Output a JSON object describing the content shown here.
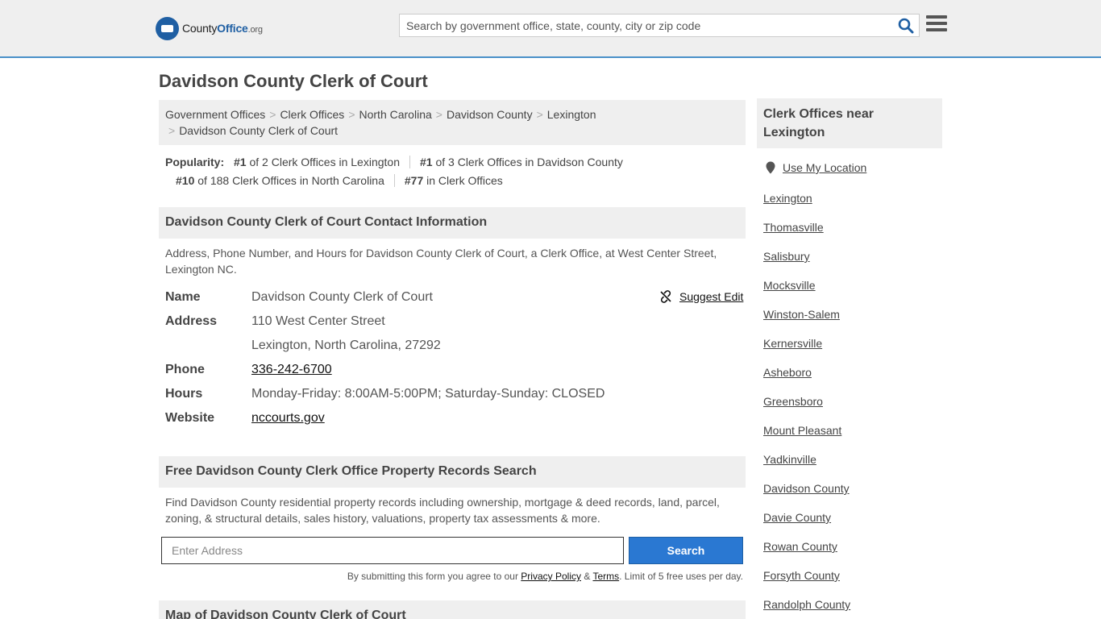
{
  "header": {
    "logo_part1": "County",
    "logo_part2": "Office",
    "logo_part3": ".org",
    "search_placeholder": "Search by government office, state, county, city or zip code"
  },
  "page_title": "Davidson County Clerk of Court",
  "breadcrumb": {
    "items": [
      "Government Offices",
      "Clerk Offices",
      "North Carolina",
      "Davidson County",
      "Lexington",
      "Davidson County Clerk of Court"
    ]
  },
  "popularity": {
    "label": "Popularity:",
    "items": [
      {
        "rank": "#1",
        "text": "of 2 Clerk Offices in Lexington"
      },
      {
        "rank": "#1",
        "text": "of 3 Clerk Offices in Davidson County"
      },
      {
        "rank": "#10",
        "text": "of 188 Clerk Offices in North Carolina"
      },
      {
        "rank": "#77",
        "text": "in Clerk Offices"
      }
    ]
  },
  "contact": {
    "heading": "Davidson County Clerk of Court Contact Information",
    "description": "Address, Phone Number, and Hours for Davidson County Clerk of Court, a Clerk Office, at West Center Street, Lexington NC.",
    "suggest_edit": "Suggest Edit",
    "name_label": "Name",
    "name_value": "Davidson County Clerk of Court",
    "address_label": "Address",
    "address_line1": "110 West Center Street",
    "address_line2": "Lexington, North Carolina, 27292",
    "phone_label": "Phone",
    "phone_value": "336-242-6700",
    "hours_label": "Hours",
    "hours_value": "Monday-Friday: 8:00AM-5:00PM; Saturday-Sunday: CLOSED",
    "website_label": "Website",
    "website_value": "nccourts.gov"
  },
  "records": {
    "heading": "Free Davidson County Clerk Office Property Records Search",
    "description": "Find Davidson County residential property records including ownership, mortgage & deed records, land, parcel, zoning, & structural details, sales history, valuations, property tax assessments & more.",
    "address_placeholder": "Enter Address",
    "search_label": "Search",
    "terms_prefix": "By submitting this form you agree to our",
    "privacy_label": "Privacy Policy",
    "amp": "&",
    "terms_label": "Terms",
    "terms_suffix": ". Limit of 5 free uses per day."
  },
  "map": {
    "heading": "Map of Davidson County Clerk of Court"
  },
  "sidebar": {
    "heading": "Clerk Offices near Lexington",
    "use_location": "Use My Location",
    "items": [
      "Lexington",
      "Thomasville",
      "Salisbury",
      "Mocksville",
      "Winston-Salem",
      "Kernersville",
      "Asheboro",
      "Greensboro",
      "Mount Pleasant",
      "Yadkinville",
      "Davidson County",
      "Davie County",
      "Rowan County",
      "Forsyth County",
      "Randolph County"
    ]
  },
  "colors": {
    "brand_blue": "#1f5fa3",
    "button_blue": "#2a78d2",
    "panel_gray": "#efefef",
    "header_border": "#4a90c8"
  }
}
